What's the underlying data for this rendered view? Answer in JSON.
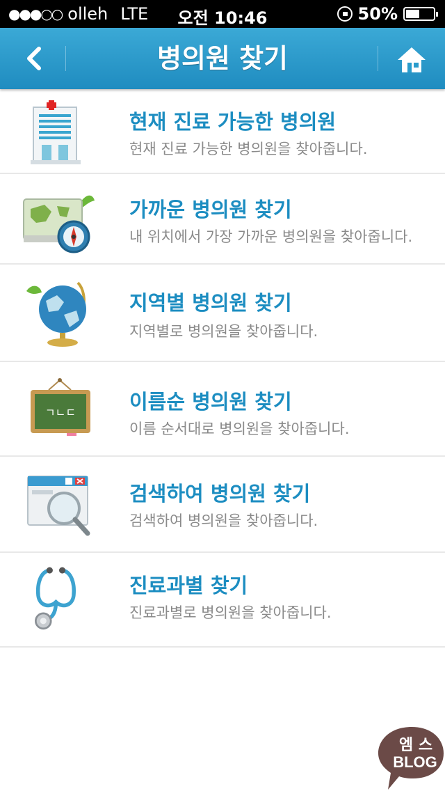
{
  "status_bar": {
    "signal": "●●●○○",
    "carrier": "olleh",
    "network": "LTE",
    "time": "오전 10:46",
    "battery_percent_label": "50%",
    "battery_level": 0.5
  },
  "nav": {
    "title": "병의원 찾기",
    "back_icon": "chevron-left-icon",
    "home_icon": "home-icon"
  },
  "menu": [
    {
      "title": "현재 진료 가능한 병의원",
      "description": "현재 진료 가능한 병의원을 찾아줍니다.",
      "icon": "hospital-building-icon"
    },
    {
      "title": "가까운 병의원 찾기",
      "description": "내 위치에서 가장 가까운 병의원을 찾아줍니다.",
      "icon": "map-compass-icon"
    },
    {
      "title": "지역별 병의원 찾기",
      "description": "지역별로 병의원을 찾아줍니다.",
      "icon": "globe-icon"
    },
    {
      "title": "이름순 병의원 찾기",
      "description": "이름 순서대로 병의원을 찾아줍니다.",
      "icon": "chalkboard-icon",
      "board_text": "ㄱㄴㄷ"
    },
    {
      "title": "검색하여 병의원 찾기",
      "description": "검색하여 병의원을 찾아줍니다.",
      "icon": "search-window-icon"
    },
    {
      "title": "진료과별 찾기",
      "description": "진료과별로 병의원을 찾아줍니다.",
      "icon": "stethoscope-icon"
    }
  ],
  "watermark": {
    "line1": "엠 스",
    "line2": "BLOG"
  },
  "colors": {
    "nav_bar": "#2a9ccc",
    "title_text": "#1c8dc1",
    "description_text": "#8a8a8a"
  }
}
